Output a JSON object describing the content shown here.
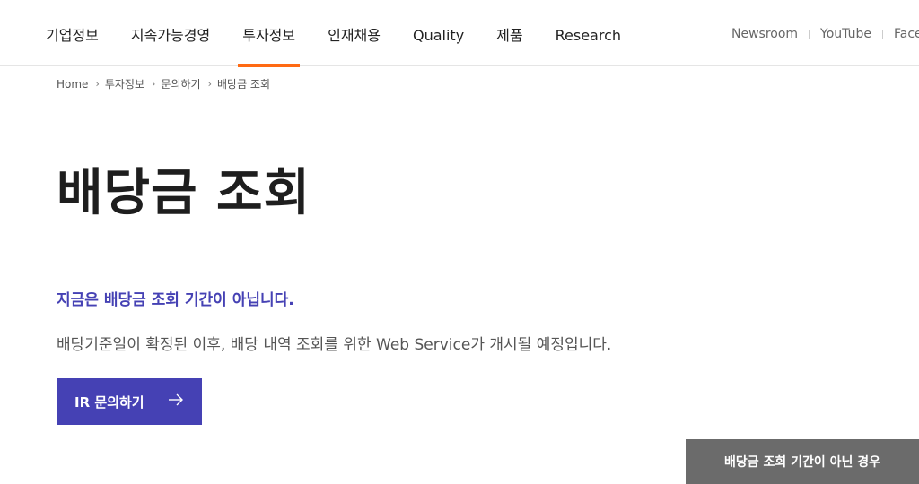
{
  "gnb": {
    "items": [
      {
        "label": "기업정보"
      },
      {
        "label": "지속가능경영"
      },
      {
        "label": "투자정보"
      },
      {
        "label": "인재채용"
      },
      {
        "label": "Quality"
      },
      {
        "label": "제품"
      },
      {
        "label": "Research"
      }
    ],
    "active_index": 2
  },
  "util": {
    "newsroom": "Newsroom",
    "youtube": "YouTube",
    "facebook": "Faceb"
  },
  "breadcrumb": {
    "items": [
      "Home",
      "투자정보",
      "문의하기",
      "배당금 조회"
    ]
  },
  "page": {
    "title": "배당금 조회",
    "notice_title": "지금은 배당금 조회 기간이 아닙니다.",
    "notice_desc": "배당기준일이 확정된 이후, 배당 내역 조회를 위한 Web Service가 개시될 예정입니다.",
    "ir_button_label": "IR 문의하기",
    "float_button_label": "배당금 조회 기간이 아닌 경우"
  },
  "colors": {
    "accent": "#4541b4",
    "active_tab": "#ff6a13",
    "float_button": "#6b6b6b"
  }
}
